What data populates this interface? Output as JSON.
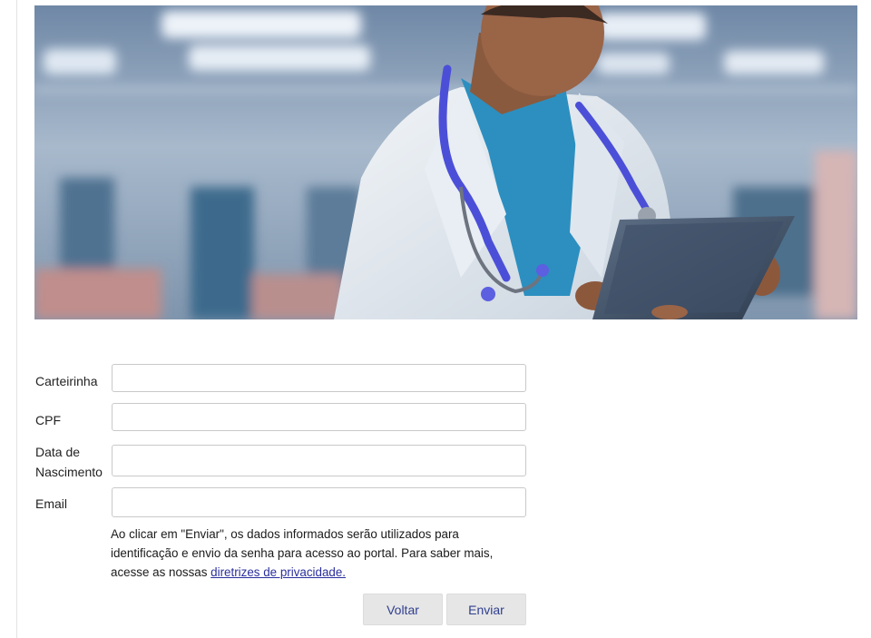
{
  "hero": {
    "image": "doctor-with-tablet"
  },
  "form": {
    "fields": [
      {
        "label": "Carteirinha",
        "value": "",
        "placeholder": ""
      },
      {
        "label": "CPF",
        "value": "",
        "placeholder": ""
      },
      {
        "label": "Data de Nascimento",
        "value": "",
        "placeholder": ""
      },
      {
        "label": "Email",
        "value": "",
        "placeholder": ""
      }
    ],
    "notice_text": "Ao clicar em \"Enviar\", os dados informados serão utilizados para identificação e envio da senha para acesso ao portal. Para saber mais, acesse as nossas ",
    "notice_link": "diretrizes de privacidade.",
    "back_label": "Voltar",
    "submit_label": "Enviar"
  },
  "colors": {
    "link": "#2a2f9c",
    "button_text": "#2f3f8f",
    "button_bg": "#e6e6e6"
  }
}
